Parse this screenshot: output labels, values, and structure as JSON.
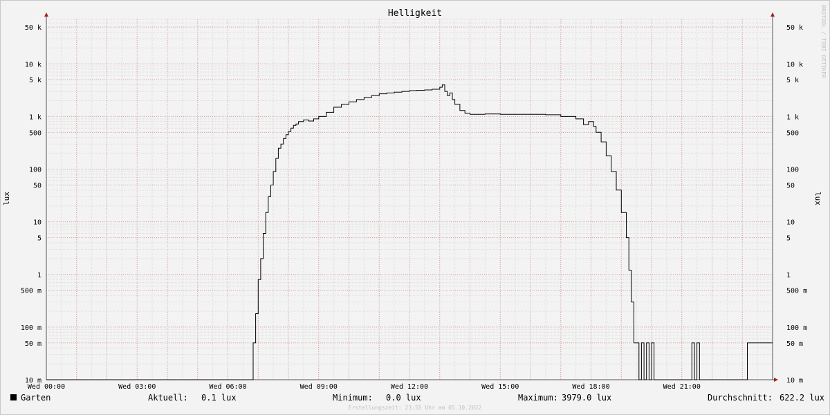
{
  "chart_data": {
    "type": "line",
    "title": "Helligkeit",
    "ylabel": "lux",
    "yscale": "log",
    "ylim": [
      0.01,
      70000
    ],
    "y_ticks": [
      {
        "value": 50000,
        "label": "50 k"
      },
      {
        "value": 10000,
        "label": "10 k"
      },
      {
        "value": 5000,
        "label": "5 k"
      },
      {
        "value": 1000,
        "label": "1 k"
      },
      {
        "value": 500,
        "label": "500"
      },
      {
        "value": 100,
        "label": "100"
      },
      {
        "value": 50,
        "label": "50"
      },
      {
        "value": 10,
        "label": "10"
      },
      {
        "value": 5,
        "label": "5"
      },
      {
        "value": 1,
        "label": "1"
      },
      {
        "value": 0.5,
        "label": "500 m"
      },
      {
        "value": 0.1,
        "label": "100 m"
      },
      {
        "value": 0.05,
        "label": "50 m"
      },
      {
        "value": 0.01,
        "label": "10 m"
      }
    ],
    "x_ticks": [
      {
        "value": "00:00",
        "label": "Wed 00:00"
      },
      {
        "value": "03:00",
        "label": "Wed 03:00"
      },
      {
        "value": "06:00",
        "label": "Wed 06:00"
      },
      {
        "value": "09:00",
        "label": "Wed 09:00"
      },
      {
        "value": "12:00",
        "label": "Wed 12:00"
      },
      {
        "value": "15:00",
        "label": "Wed 15:00"
      },
      {
        "value": "18:00",
        "label": "Wed 18:00"
      },
      {
        "value": "21:00",
        "label": "Wed 21:00"
      }
    ],
    "xlim": [
      "00:00",
      "24:00"
    ],
    "grid": true,
    "series": [
      {
        "name": "Garten",
        "color": "#000000",
        "x": [
          "00:00",
          "06:50",
          "06:55",
          "07:00",
          "07:05",
          "07:10",
          "07:15",
          "07:20",
          "07:25",
          "07:30",
          "07:35",
          "07:40",
          "07:45",
          "07:50",
          "07:55",
          "08:00",
          "08:05",
          "08:10",
          "08:15",
          "08:20",
          "08:30",
          "08:40",
          "08:50",
          "09:00",
          "09:15",
          "09:30",
          "09:45",
          "10:00",
          "10:15",
          "10:30",
          "10:45",
          "11:00",
          "11:15",
          "11:30",
          "11:45",
          "12:00",
          "12:15",
          "12:30",
          "12:45",
          "13:00",
          "13:05",
          "13:10",
          "13:15",
          "13:20",
          "13:25",
          "13:30",
          "13:40",
          "13:50",
          "14:00",
          "14:30",
          "15:00",
          "15:30",
          "16:00",
          "16:30",
          "17:00",
          "17:30",
          "17:45",
          "17:55",
          "18:05",
          "18:10",
          "18:20",
          "18:30",
          "18:40",
          "18:50",
          "19:00",
          "19:10",
          "19:15",
          "19:20",
          "19:25",
          "19:30",
          "19:35",
          "19:40",
          "19:45",
          "19:50",
          "19:55",
          "20:00",
          "20:05",
          "20:10",
          "20:15",
          "20:20",
          "20:25",
          "20:30",
          "20:40",
          "20:45",
          "21:20",
          "21:25",
          "21:30",
          "21:35",
          "23:10",
          "23:15",
          "23:25",
          "23:30",
          "23:35",
          "23:40",
          "24:00"
        ],
        "values": [
          0.01,
          0.05,
          0.18,
          0.8,
          2.0,
          6.0,
          15.0,
          30.0,
          50.0,
          90.0,
          160.0,
          250.0,
          300.0,
          380.0,
          450.0,
          520.0,
          600.0,
          680.0,
          720.0,
          800.0,
          860.0,
          820.0,
          900.0,
          1000.0,
          1200.0,
          1500.0,
          1700.0,
          1900.0,
          2100.0,
          2300.0,
          2500.0,
          2700.0,
          2800.0,
          2900.0,
          3000.0,
          3100.0,
          3150.0,
          3200.0,
          3300.0,
          3600.0,
          3979.0,
          3000.0,
          2500.0,
          2800.0,
          2100.0,
          1700.0,
          1300.0,
          1150.0,
          1100.0,
          1120.0,
          1100.0,
          1100.0,
          1100.0,
          1080.0,
          1000.0,
          900.0,
          700.0,
          800.0,
          650.0,
          500.0,
          330.0,
          180.0,
          90.0,
          40.0,
          15.0,
          5.0,
          1.2,
          0.3,
          0.05,
          0.05,
          0.01,
          0.05,
          0.01,
          0.05,
          0.01,
          0.05,
          0.01,
          0.01,
          0.01,
          0.01,
          0.01,
          0.01,
          0.01,
          0.01,
          0.05,
          0.01,
          0.05,
          0.01,
          0.05,
          0.05,
          0.05,
          0.05,
          0.05,
          0.05,
          0.05
        ]
      }
    ]
  },
  "legend": {
    "series_name": "Garten",
    "current_label": "Aktuell:",
    "current_value": "0.1 lux",
    "min_label": "Minimum:",
    "min_value": "0.0 lux",
    "max_label": "Maximum:",
    "max_value": "3979.0 lux",
    "avg_label": "Durchschnitt:",
    "avg_value": "622.2 lux"
  },
  "watermark": "RRDTOOL / TOBI OETIKER",
  "footer": "Erstellungszeit: 23:55 Uhr am 05.10.2022"
}
